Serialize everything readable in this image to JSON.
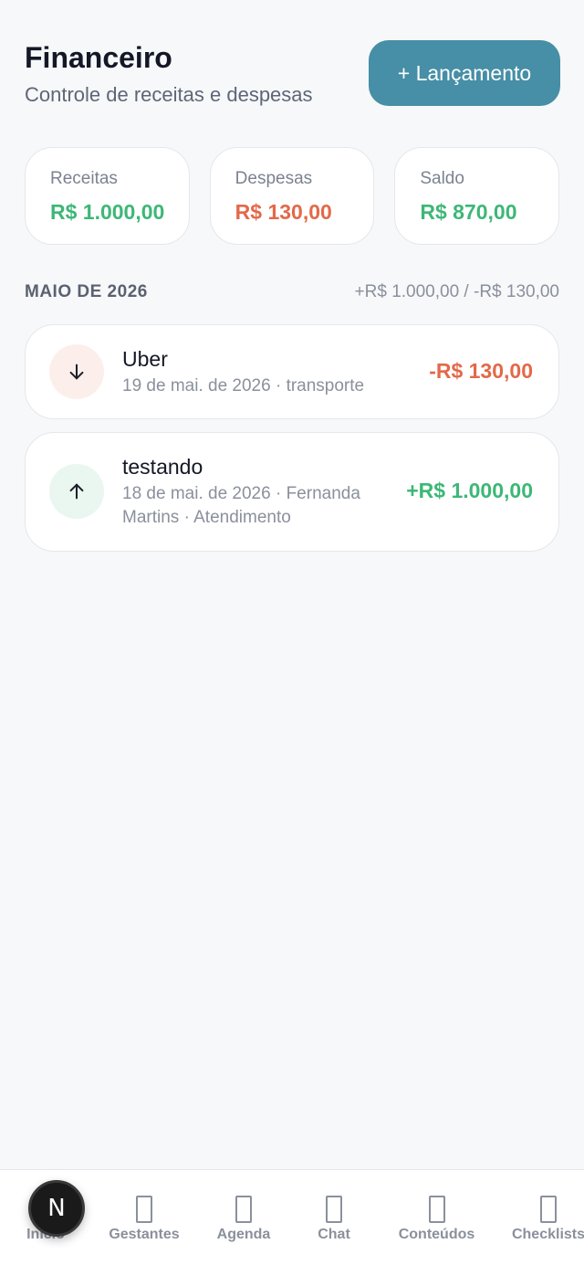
{
  "header": {
    "title": "Financeiro",
    "subtitle": "Controle de receitas e despesas",
    "add_button": "+ Lançamento"
  },
  "summary": {
    "income_label": "Receitas",
    "income_value": "R$ 1.000,00",
    "expense_label": "Despesas",
    "expense_value": "R$ 130,00",
    "balance_label": "Saldo",
    "balance_value": "R$ 870,00"
  },
  "month": {
    "title": "MAIO DE 2026",
    "totals": "+R$ 1.000,00 / -R$ 130,00"
  },
  "transactions": [
    {
      "name": "Uber",
      "meta": "19 de mai. de 2026 · transporte",
      "amount": "-R$ 130,00",
      "direction": "expense",
      "icon": "arrow-down-icon"
    },
    {
      "name": "testando",
      "meta": "18 de mai. de 2026 · Fernanda Martins · Atendimento",
      "amount": "+R$ 1.000,00",
      "direction": "income",
      "icon": "arrow-up-icon"
    }
  ],
  "nav": {
    "items": [
      {
        "label": "Início",
        "icon": "home-icon"
      },
      {
        "label": "Gestantes",
        "icon": "gestantes-icon"
      },
      {
        "label": "Agenda",
        "icon": "calendar-icon"
      },
      {
        "label": "Chat",
        "icon": "chat-icon"
      },
      {
        "label": "Conteúdos",
        "icon": "content-icon"
      },
      {
        "label": "Checklists",
        "icon": "checklist-icon"
      }
    ],
    "badge_letter": "N"
  },
  "colors": {
    "accent": "#468fa6",
    "income": "#3db777",
    "expense": "#e36949",
    "background": "#f7f8fa"
  }
}
